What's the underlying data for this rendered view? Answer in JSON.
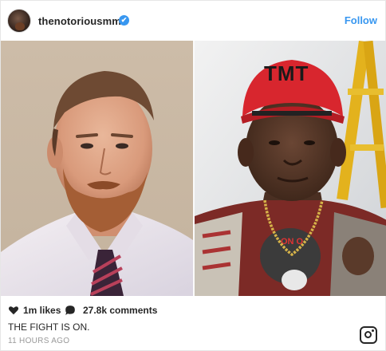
{
  "post": {
    "username": "thenotoriousmma",
    "verified_badge": "✔",
    "follow_label": "Follow",
    "likes": "1m likes",
    "comments": "27.8k comments",
    "caption": "THE FIGHT IS ON.",
    "time": "11 HOURS AGO"
  },
  "right_photo": {
    "cap_text": "TMT"
  },
  "icons": {
    "like": "heart-icon",
    "comment": "comment-bubble-icon",
    "brand": "instagram-logo-icon",
    "verified": "verified-badge-icon"
  },
  "colors": {
    "link": "#3897f0",
    "text": "#262626",
    "muted": "#999999",
    "cap_red": "#d8262e"
  }
}
